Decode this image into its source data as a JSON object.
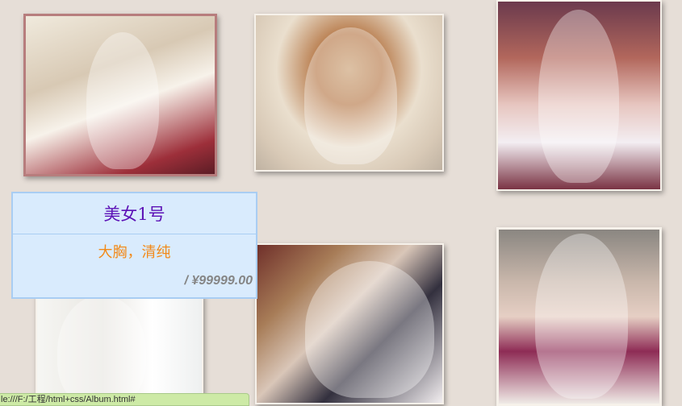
{
  "gallery": {
    "photos": [
      {
        "id": "photo-1"
      },
      {
        "id": "photo-2"
      },
      {
        "id": "photo-3"
      },
      {
        "id": "photo-4"
      },
      {
        "id": "photo-5"
      },
      {
        "id": "photo-6"
      }
    ]
  },
  "info_card": {
    "title": "美女1号",
    "description": "大胸，清纯",
    "price": "/ ¥99999.00"
  },
  "status_bar": {
    "url": "le:///F:/工程/html+css/Album.html#"
  },
  "colors": {
    "background": "#e6ded7",
    "card_background": "#d9ebfd",
    "card_border": "#a9cdf3",
    "title_color": "#5c11b6",
    "description_color": "#f28a19",
    "price_color": "#858585",
    "status_bar": "#cdeaa6"
  }
}
